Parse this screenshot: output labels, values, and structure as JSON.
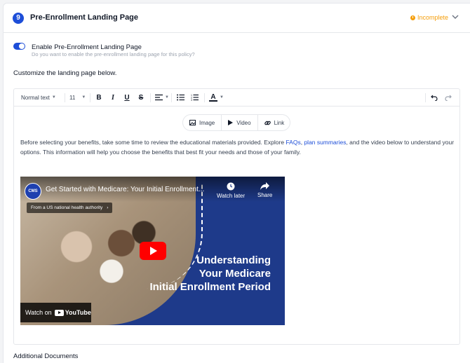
{
  "section": {
    "step_number": "9",
    "title": "Pre-Enrollment Landing Page",
    "status": "Incomplete",
    "status_color": "#f59e0b"
  },
  "toggle": {
    "enabled": true,
    "label": "Enable Pre-Enrollment Landing Page",
    "sublabel": "Do you want to enable the pre-enrollment landing page for this policy?"
  },
  "customize_label": "Customize the landing page below.",
  "toolbar": {
    "text_style": "Normal text",
    "font_size": "11",
    "bold_icon": "bold-icon",
    "italic_icon": "italic-icon",
    "underline_icon": "underline-icon",
    "strike_icon": "strikethrough-icon"
  },
  "insert": {
    "image": "Image",
    "video": "Video",
    "link": "Link"
  },
  "body": {
    "text_before": "Before selecting your benefits, take some time to review the educational materials provided. Explore ",
    "link1": "FAQs",
    "sep": ", ",
    "link2": "plan summaries",
    "text_after": ", and the video below to understand your options. This information will help you choose the benefits that best fit your needs and those of your family."
  },
  "video": {
    "channel_logo": "CMS",
    "title": "Get Started with Medicare: Your Initial Enrollment...",
    "watch_later": "Watch later",
    "share": "Share",
    "authority": "From a US national health authority",
    "headline_1": "Understanding",
    "headline_2": "Your Medicare",
    "headline_3": "Initial Enrollment Period",
    "watch_on": "Watch on",
    "youtube": "YouTube"
  },
  "additional_documents": "Additional Documents",
  "colors": {
    "accent": "#1d4ed8",
    "video_bg": "#1e3a8a"
  }
}
